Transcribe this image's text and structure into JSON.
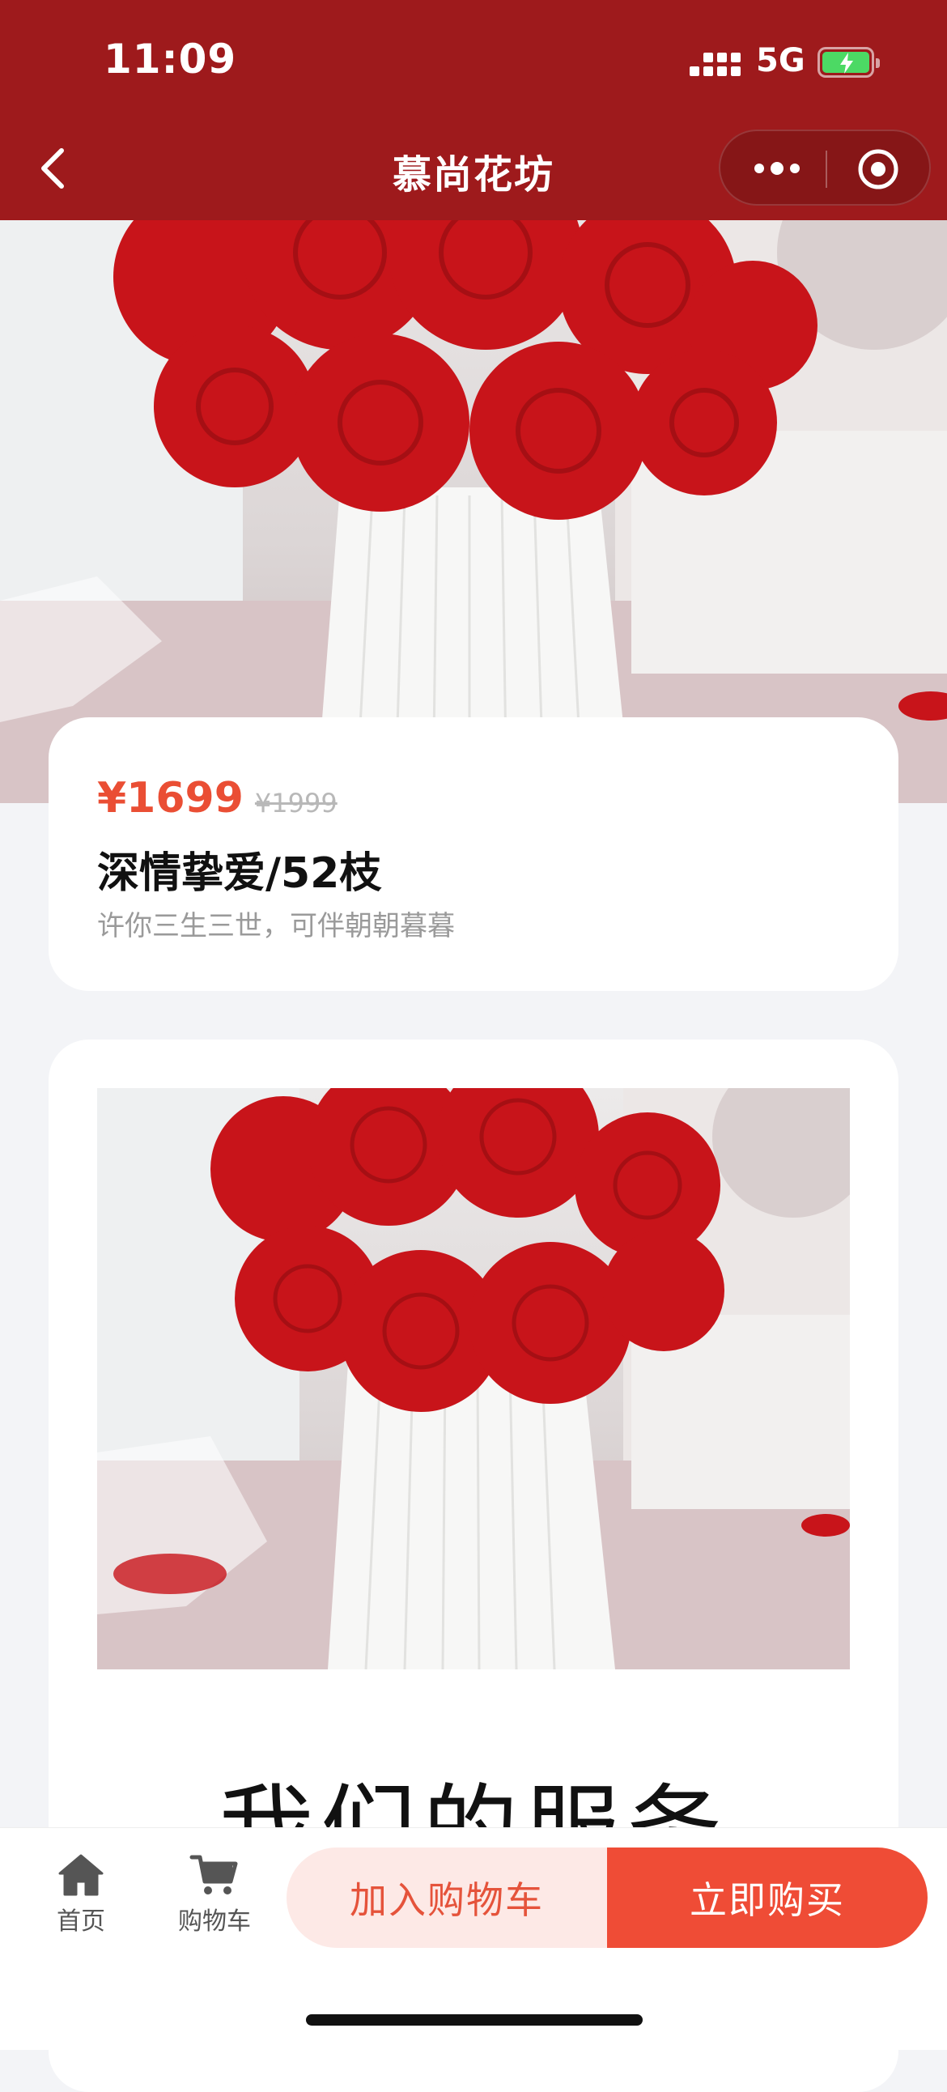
{
  "status_bar": {
    "time": "11:09",
    "network": "5G"
  },
  "nav": {
    "title": "慕尚花坊"
  },
  "product": {
    "price": "¥1699",
    "original_price": "¥1999",
    "name": "深情挚爱/52枝",
    "subtitle": "许你三生三世，可伴朝朝暮暮"
  },
  "detail": {
    "service_heading": "我们的服务"
  },
  "bottom_bar": {
    "home_label": "首页",
    "cart_label": "购物车",
    "add_to_cart": "加入购物车",
    "buy_now": "立即购买"
  },
  "colors": {
    "header_bg": "#9e1a1c",
    "price": "#ea4e34",
    "buy_button": "#ef4c36",
    "add_button_bg": "#fde9e6",
    "add_button_text": "#e5533b",
    "battery": "#4cd964"
  },
  "icons": {
    "back": "chevron-left-icon",
    "more": "more-dots-icon",
    "close": "target-circle-icon",
    "home": "home-icon",
    "cart": "cart-icon"
  }
}
